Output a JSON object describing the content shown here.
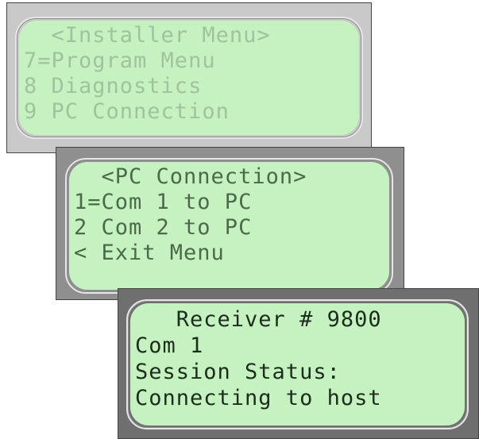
{
  "screens": [
    {
      "lines": [
        "  <Installer Menu>",
        "7=Program Menu",
        "8 Diagnostics",
        "9 PC Connection"
      ]
    },
    {
      "lines": [
        "  <PC Connection>",
        "1=Com 1 to PC",
        "2 Com 2 to PC",
        "< Exit Menu"
      ]
    },
    {
      "lines": [
        "   Receiver # 9800",
        "Com 1",
        "Session Status:",
        "Connecting to host"
      ]
    }
  ],
  "colors": {
    "lcd_background": "#c6f2c2",
    "lcd_text_faded": "#9fc39d",
    "lcd_text_medium": "#4a6a48",
    "lcd_text_dark": "#1a2e19"
  }
}
